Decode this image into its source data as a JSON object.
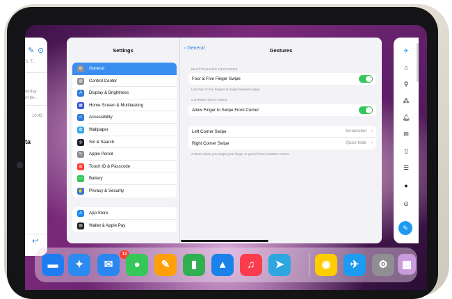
{
  "left_card": {
    "snippets": [
      "S. T...",
      "terday",
      "nt be...",
      "10:43"
    ],
    "heading": "ta"
  },
  "settings": {
    "sidebar_title": "Settings",
    "group1": [
      {
        "label": "General",
        "icon": "gear-icon",
        "color": "#8e8e93",
        "selected": true
      },
      {
        "label": "Control Center",
        "icon": "switches-icon",
        "color": "#8e8e93"
      },
      {
        "label": "Display & Brightness",
        "icon": "text-size-icon",
        "color": "#2f7bd8"
      },
      {
        "label": "Home Screen & Multitasking",
        "icon": "grid-icon",
        "color": "#3650d8"
      },
      {
        "label": "Accessibility",
        "icon": "accessibility-icon",
        "color": "#2f7bd8"
      },
      {
        "label": "Wallpaper",
        "icon": "flower-icon",
        "color": "#38a8e8"
      },
      {
        "label": "Siri & Search",
        "icon": "siri-icon",
        "color": "#1c1c2e"
      },
      {
        "label": "Apple Pencil",
        "icon": "pencil-icon",
        "color": "#8e8e93"
      },
      {
        "label": "Touch ID & Passcode",
        "icon": "fingerprint-icon",
        "color": "#ff3b30"
      },
      {
        "label": "Battery",
        "icon": "battery-icon",
        "color": "#34c759"
      },
      {
        "label": "Privacy & Security",
        "icon": "hand-icon",
        "color": "#2f7bd8"
      }
    ],
    "group2": [
      {
        "label": "App Store",
        "icon": "app-store-icon",
        "color": "#1d8cf0"
      },
      {
        "label": "Wallet & Apple Pay",
        "icon": "wallet-icon",
        "color": "#1c1c1e"
      }
    ],
    "detail": {
      "back_label": "General",
      "title": "Gestures",
      "sections": {
        "multitasking_header": "MULTITASKING GESTURES",
        "four_five": {
          "label": "Four & Five Finger Swipe",
          "on": true
        },
        "multitasking_footer": "Use four or five fingers to swipe between apps.",
        "corner_header": "CORNER GESTURES",
        "allow_corner": {
          "label": "Allow Finger to Swipe From Corner",
          "on": true
        },
        "left_corner": {
          "label": "Left Corner Swipe",
          "value": "Screenshot"
        },
        "right_corner": {
          "label": "Right Corner Swipe",
          "value": "Quick Note"
        },
        "corner_footer": "Actions when you swipe your finger or pencil from a bottom corner."
      }
    }
  },
  "twitter_sidebar": {
    "icons": [
      "twitter-bird-icon",
      "home-icon",
      "search-icon",
      "spaces-icon",
      "bell-icon",
      "mail-icon",
      "bookmark-icon",
      "list-icon",
      "profile-icon",
      "more-icon",
      "compose-icon"
    ]
  },
  "dock": {
    "apps": [
      {
        "name": "files-app-icon",
        "color": "#1f7cf0",
        "glyph": "▬"
      },
      {
        "name": "safari-app-icon",
        "color": "#2d8af0",
        "glyph": "✦"
      },
      {
        "name": "mail-app-icon",
        "color": "#2c86f0",
        "glyph": "✉"
      },
      {
        "name": "messages-app-icon",
        "color": "#35c759",
        "glyph": "●"
      },
      {
        "name": "pages-app-icon",
        "color": "#ff9f0a",
        "glyph": "✎"
      },
      {
        "name": "numbers-app-icon",
        "color": "#30b050",
        "glyph": "▮"
      },
      {
        "name": "keynote-app-icon",
        "color": "#1a82e8",
        "glyph": "▲"
      },
      {
        "name": "music-app-icon",
        "color": "#fa3c4c",
        "glyph": "♫"
      },
      {
        "name": "telegram-app-icon",
        "color": "#2ea6e0",
        "glyph": "➤"
      },
      {
        "name": "tips-app-icon",
        "color": "#ffcc00",
        "glyph": "◉"
      },
      {
        "name": "twitter-app-icon",
        "color": "#1d9bf0",
        "glyph": "✈"
      },
      {
        "name": "settings-app-icon",
        "color": "#8e8e93",
        "glyph": "⚙"
      },
      {
        "name": "app-library-icon",
        "color": "#c89bdc",
        "glyph": "▦"
      }
    ],
    "mail_badge": "13"
  }
}
